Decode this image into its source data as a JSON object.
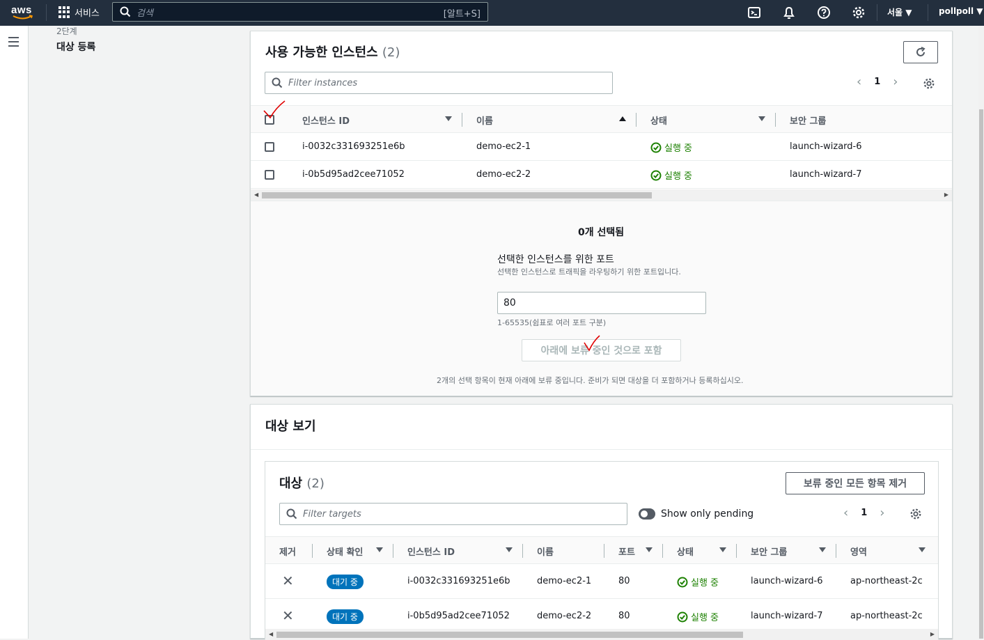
{
  "topbar": {
    "logo_text": "aws",
    "services_label": "서비스",
    "search_placeholder": "검색",
    "search_shortcut": "[알트+S]",
    "region": "서울 ▼",
    "user": "pollpoll ▼"
  },
  "steps": {
    "step_num": "2단계",
    "step_name": "대상 등록"
  },
  "available": {
    "title": "사용 가능한 인스턴스",
    "count": "(2)",
    "filter_placeholder": "Filter instances",
    "page": "1",
    "columns": [
      "인스턴스 ID",
      "이름",
      "상태",
      "보안 그룹"
    ],
    "rows": [
      {
        "id": "i-0032c331693251e6b",
        "name": "demo-ec2-1",
        "state": "실행 중",
        "sg": "launch-wizard-6"
      },
      {
        "id": "i-0b5d95ad2cee71052",
        "name": "demo-ec2-2",
        "state": "실행 중",
        "sg": "launch-wizard-7"
      }
    ],
    "selected_count": "0개 선택됨",
    "port_label": "선택한 인스턴스를 위한 포트",
    "port_desc": "선택한 인스턴스로 트래픽을 라우팅하기 위한 포트입니다.",
    "port_value": "80",
    "port_hint": "1-65535(쉼표로 여러 포트 구분)",
    "include_button": "아래에 보류 중인 것으로 포함",
    "pending_note": "2개의 선택 항목이 현재 아래에 보류 중입니다. 준비가 되면 대상을 더 포함하거나 등록하십시오."
  },
  "review": {
    "title": "대상 보기",
    "targets_title": "대상",
    "targets_count": "(2)",
    "remove_all_button": "보류 중인 모든 항목 제거",
    "filter_placeholder": "Filter targets",
    "toggle_label": "Show only pending",
    "page": "1",
    "columns": [
      "제거",
      "상태 확인",
      "인스턴스 ID",
      "이름",
      "포트",
      "상태",
      "보안 그룹",
      "영역"
    ],
    "rows": [
      {
        "health": "대기 중",
        "id": "i-0032c331693251e6b",
        "name": "demo-ec2-1",
        "port": "80",
        "state": "실행 중",
        "sg": "launch-wizard-6",
        "zone": "ap-northeast-2c"
      },
      {
        "health": "대기 중",
        "id": "i-0b5d95ad2cee71052",
        "name": "demo-ec2-2",
        "port": "80",
        "state": "실행 중",
        "sg": "launch-wizard-7",
        "zone": "ap-northeast-2c"
      }
    ]
  },
  "colors": {
    "topbar": "#232f3e",
    "running": "#1d8102",
    "pending_badge": "#0073bb",
    "annotation": "#e00000"
  }
}
